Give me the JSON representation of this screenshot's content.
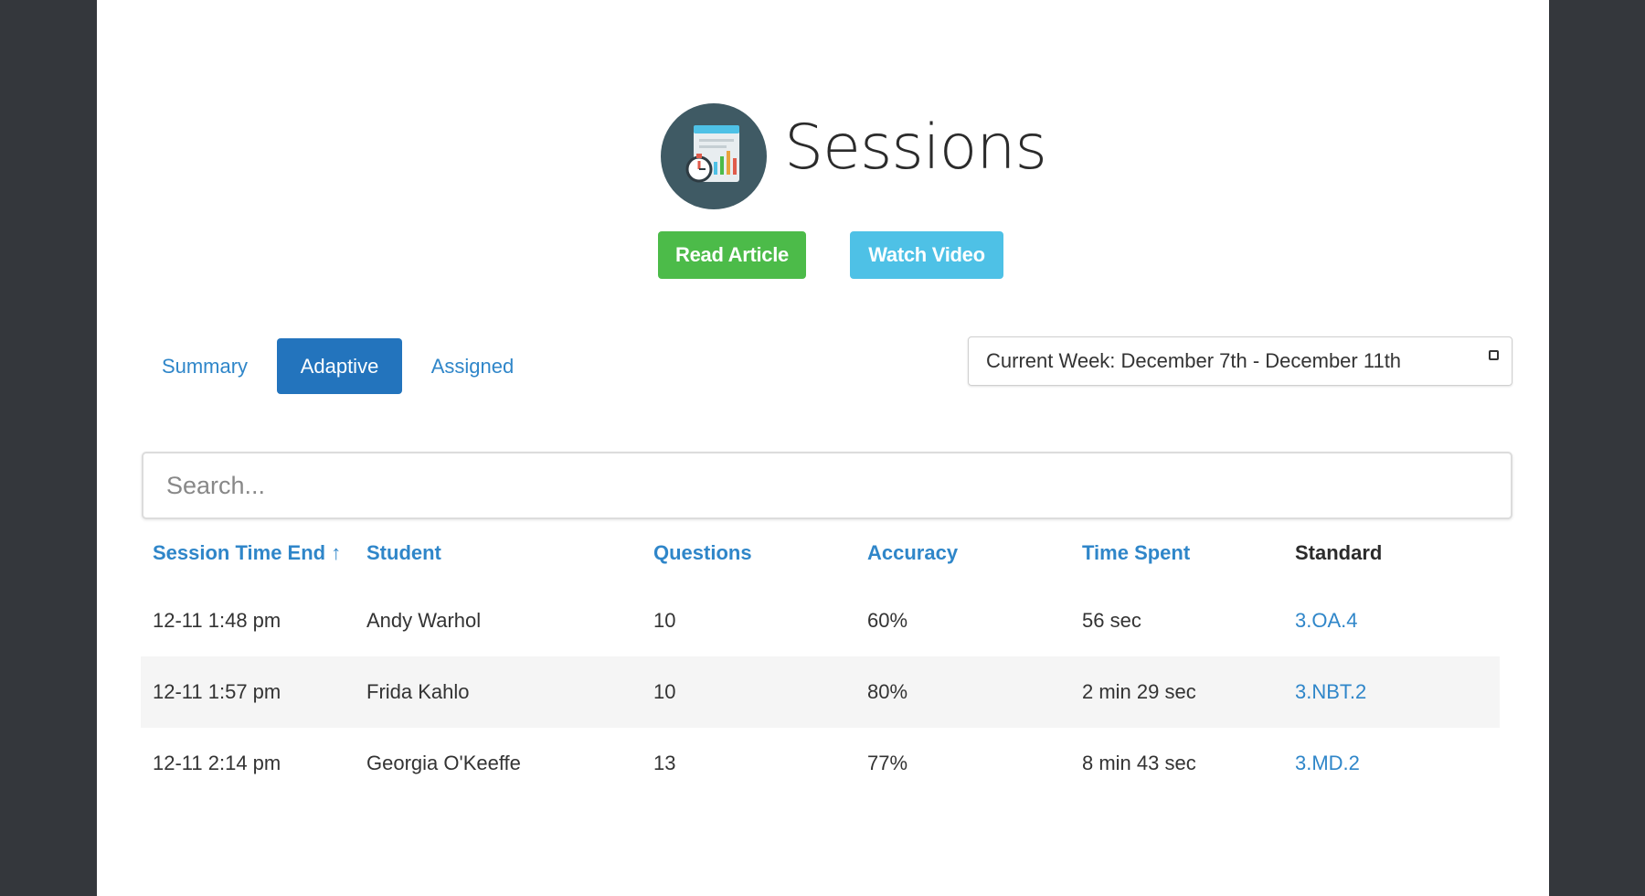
{
  "header": {
    "title": "Sessions",
    "read_article_label": "Read Article",
    "watch_video_label": "Watch Video",
    "logo_icon": "sessions-chart-stopwatch-icon"
  },
  "tabs": [
    {
      "label": "Summary",
      "active": false
    },
    {
      "label": "Adaptive",
      "active": true
    },
    {
      "label": "Assigned",
      "active": false
    }
  ],
  "week_selector": {
    "label": "Current Week: December 7th - December 11th",
    "icon": "square-icon"
  },
  "search": {
    "placeholder": "Search...",
    "value": ""
  },
  "table": {
    "columns": [
      {
        "label": "Session Time End ↑",
        "sortable": true
      },
      {
        "label": "Student",
        "sortable": true
      },
      {
        "label": "Questions",
        "sortable": true
      },
      {
        "label": "Accuracy",
        "sortable": true
      },
      {
        "label": "Time Spent",
        "sortable": true
      },
      {
        "label": "Standard",
        "sortable": false
      }
    ],
    "rows": [
      {
        "time_end": "12-11 1:48 pm",
        "student": "Andy Warhol",
        "questions": "10",
        "accuracy": "60%",
        "time_spent": "56 sec",
        "standard": "3.OA.4"
      },
      {
        "time_end": "12-11 1:57 pm",
        "student": "Frida Kahlo",
        "questions": "10",
        "accuracy": "80%",
        "time_spent": "2 min 29 sec",
        "standard": "3.NBT.2"
      },
      {
        "time_end": "12-11 2:14 pm",
        "student": "Georgia O'Keeffe",
        "questions": "13",
        "accuracy": "77%",
        "time_spent": "8 min 43 sec",
        "standard": "3.MD.2"
      }
    ]
  },
  "colors": {
    "background_frame": "#34373c",
    "link_blue": "#2f86c9",
    "active_tab": "#2374bd",
    "read_article_green": "#4cbb49",
    "watch_video_cyan": "#4ec1e6",
    "logo_circle": "#3f5a64",
    "row_alt": "#f5f5f5"
  }
}
